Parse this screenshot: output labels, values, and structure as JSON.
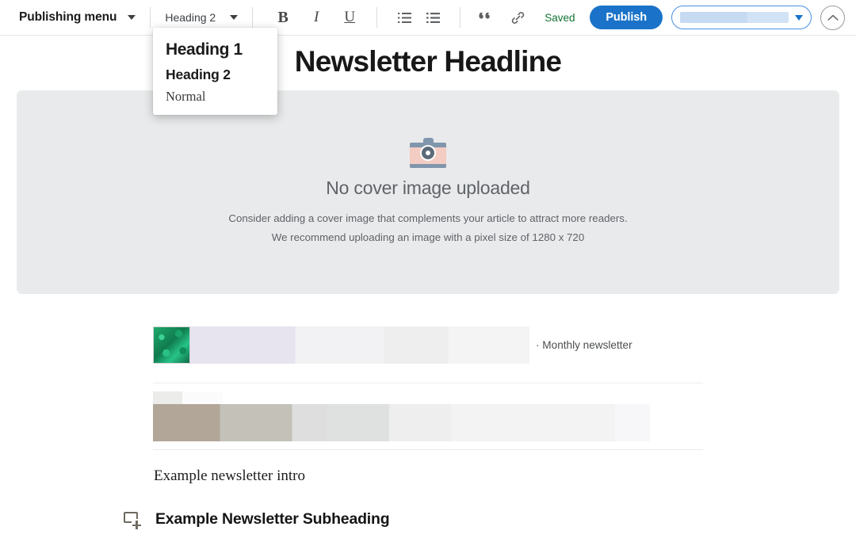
{
  "toolbar": {
    "publishing_menu_label": "Publishing menu",
    "publishing_menu_caret": "chevron-down-icon",
    "style_select_value": "Heading 2",
    "style_select_caret": "chevron-down-icon",
    "format_buttons": [
      {
        "name": "bold-button",
        "glyph": "B"
      },
      {
        "name": "italic-button",
        "glyph": "I"
      },
      {
        "name": "underline-button",
        "glyph": "U"
      }
    ],
    "list_buttons": [
      {
        "name": "ordered-list-icon"
      },
      {
        "name": "unordered-list-icon"
      }
    ],
    "quote_button": "quote-icon",
    "link_button": "link-icon",
    "saved_status": "Saved",
    "saved_color": "#137333",
    "publish_label": "Publish",
    "publish_color": "#1a73c8",
    "pill_select": {
      "name": "publication-select",
      "value": "",
      "loading": true,
      "border_color": "#4a90e2"
    },
    "collapse_button": "chevron-up-icon"
  },
  "style_dropdown": {
    "open": true,
    "items": [
      {
        "label": "Heading 1",
        "style": "h1"
      },
      {
        "label": "Heading 2",
        "style": "h2"
      },
      {
        "label": "Normal",
        "style": "normal"
      }
    ]
  },
  "editor": {
    "headline": "Newsletter Headline",
    "cover": {
      "icon": "camera-icon",
      "title": "No cover image uploaded",
      "subtitle_line1": "Consider adding a cover image that complements your article to attract more readers.",
      "subtitle_line2": "We recommend uploading an image with a pixel size of 1280 x 720",
      "background_color": "#e9eaeb"
    },
    "byline": {
      "avatar": "author-thumbnail-plants",
      "text": "· Monthly newsletter"
    },
    "intro_text": "Example newsletter intro",
    "subheading": {
      "insert_icon": "insert-block-icon",
      "text": "Example Newsletter Subheading"
    }
  }
}
